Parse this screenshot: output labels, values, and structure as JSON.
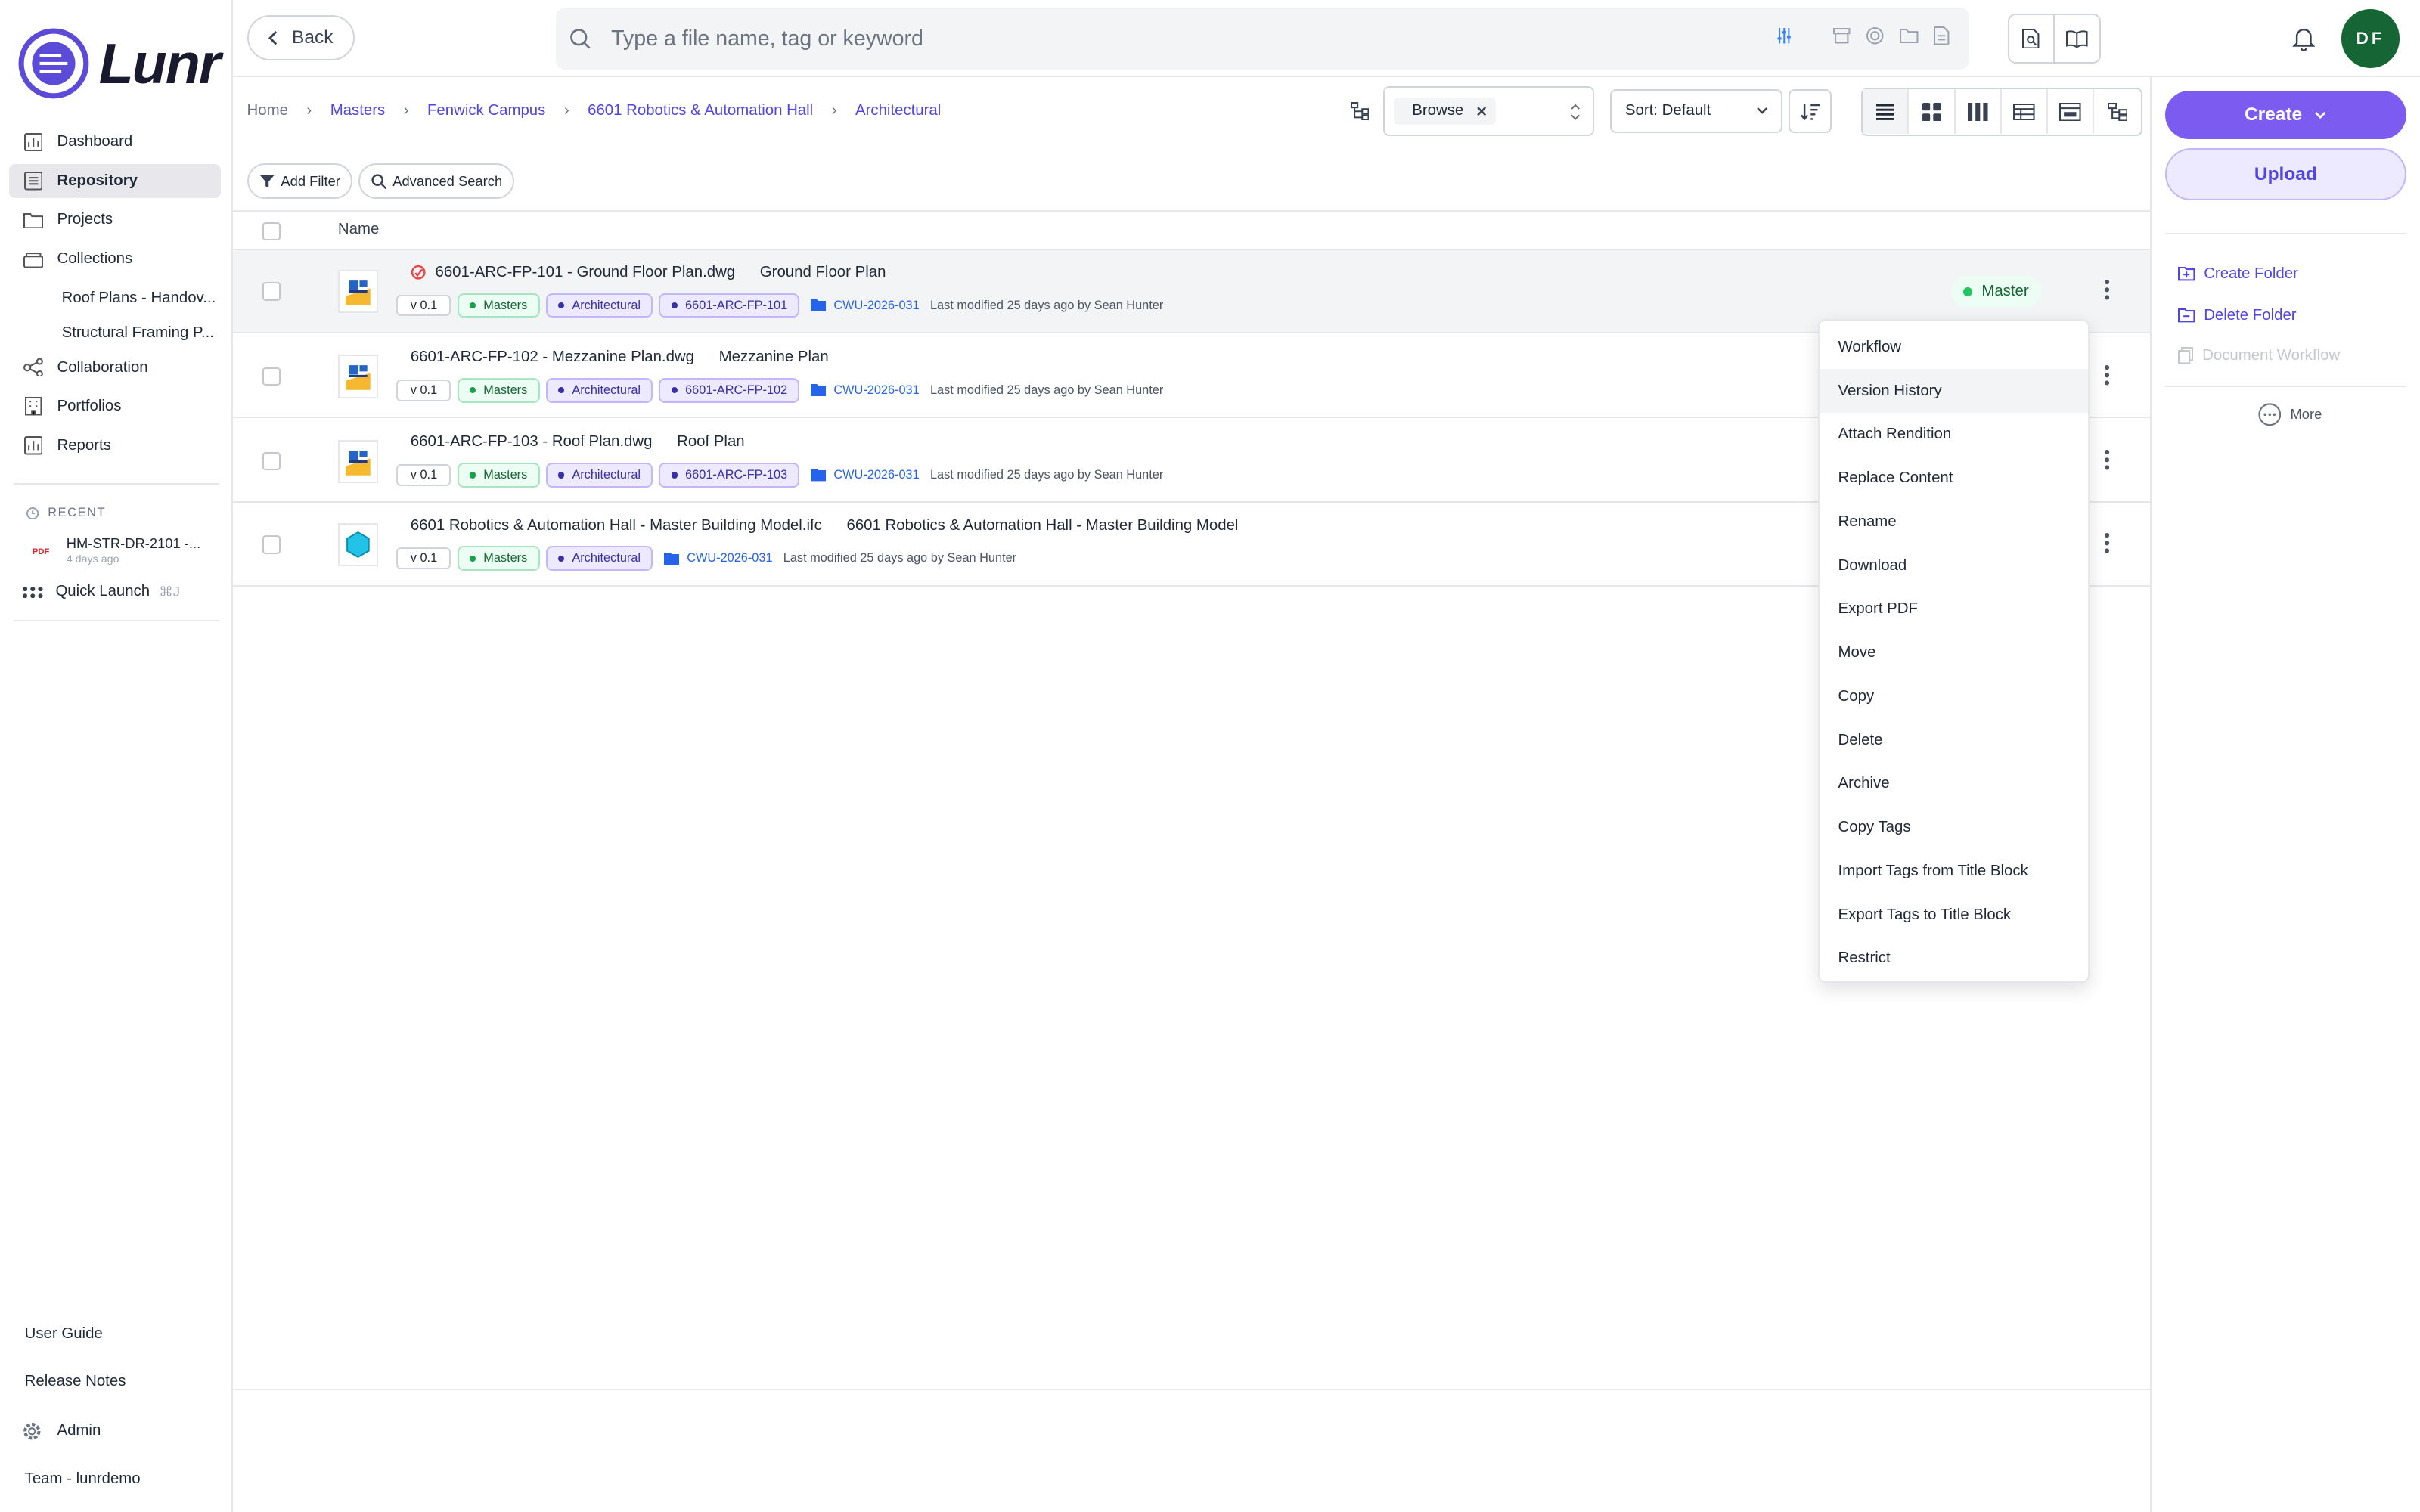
{
  "brand": {
    "name": "Lunr"
  },
  "sidebar": {
    "items": [
      {
        "label": "Dashboard",
        "icon": "chart-icon"
      },
      {
        "label": "Repository",
        "icon": "repository-icon",
        "active": true
      },
      {
        "label": "Projects",
        "icon": "folder-icon"
      },
      {
        "label": "Collections",
        "icon": "collections-icon"
      }
    ],
    "collection_items": [
      "Roof Plans - Handov...",
      "Structural Framing P..."
    ],
    "items2": [
      {
        "label": "Collaboration",
        "icon": "share-icon"
      },
      {
        "label": "Portfolios",
        "icon": "building-icon"
      },
      {
        "label": "Reports",
        "icon": "chart-icon"
      }
    ],
    "recent_label": "RECENT",
    "recent": {
      "name": "HM-STR-DR-2101 -...",
      "time": "4 days ago",
      "type": "PDF"
    },
    "quick_launch": {
      "label": "Quick Launch",
      "shortcut": "⌘J"
    },
    "footer": {
      "user_guide": "User Guide",
      "release_notes": "Release Notes",
      "admin": "Admin",
      "team": "Team - lunrdemo"
    }
  },
  "topbar": {
    "back_label": "Back",
    "search_placeholder": "Type a file name, tag or keyword",
    "avatar_initials": "DF"
  },
  "breadcrumb": [
    "Home",
    "Masters",
    "Fenwick Campus",
    "6601 Robotics & Automation Hall",
    "Architectural"
  ],
  "toolbar": {
    "browse_chip": "Browse",
    "sort_label": "Sort: Default"
  },
  "filters": {
    "add_filter": "Add Filter",
    "advanced_search": "Advanced Search"
  },
  "table": {
    "header_name": "Name",
    "rows": [
      {
        "filename": "6601-ARC-FP-101 - Ground Floor Plan.dwg",
        "title": "Ground Floor Plan",
        "version": "v 0.1",
        "tags": [
          "Masters",
          "Architectural",
          "6601-ARC-FP-101"
        ],
        "folder": "CWU-2026-031",
        "modified": "Last modified 25 days ago by Sean Hunter",
        "status": "Master",
        "thumb": "dwg-icon"
      },
      {
        "filename": "6601-ARC-FP-102 - Mezzanine Plan.dwg",
        "title": "Mezzanine Plan",
        "version": "v 0.1",
        "tags": [
          "Masters",
          "Architectural",
          "6601-ARC-FP-102"
        ],
        "folder": "CWU-2026-031",
        "modified": "Last modified 25 days ago by Sean Hunter",
        "thumb": "dwg-icon"
      },
      {
        "filename": "6601-ARC-FP-103 - Roof Plan.dwg",
        "title": "Roof Plan",
        "version": "v 0.1",
        "tags": [
          "Masters",
          "Architectural",
          "6601-ARC-FP-103"
        ],
        "folder": "CWU-2026-031",
        "modified": "Last modified 25 days ago by Sean Hunter",
        "thumb": "dwg-icon"
      },
      {
        "filename": "6601 Robotics & Automation Hall - Master Building Model.ifc",
        "title": "6601 Robotics & Automation Hall - Master Building Model",
        "version": "v 0.1",
        "tags": [
          "Masters",
          "Architectural"
        ],
        "folder": "CWU-2026-031",
        "modified": "Last modified 25 days ago by Sean Hunter",
        "thumb": "ifc-icon"
      }
    ]
  },
  "context_menu": [
    "Workflow",
    "Version History",
    "Attach Rendition",
    "Replace Content",
    "Rename",
    "Download",
    "Export PDF",
    "Move",
    "Copy",
    "Delete",
    "Archive",
    "Copy Tags",
    "Import Tags from Title Block",
    "Export Tags to Title Block",
    "Restrict"
  ],
  "right_panel": {
    "create_label": "Create",
    "upload_label": "Upload",
    "create_folder": "Create Folder",
    "delete_folder": "Delete Folder",
    "document_workflow": "Document Workflow",
    "more": "More"
  },
  "colors": {
    "accent": "#7c5cf0",
    "link": "#4f46e5",
    "avatar": "#166534",
    "master_green": "#22c55e"
  }
}
